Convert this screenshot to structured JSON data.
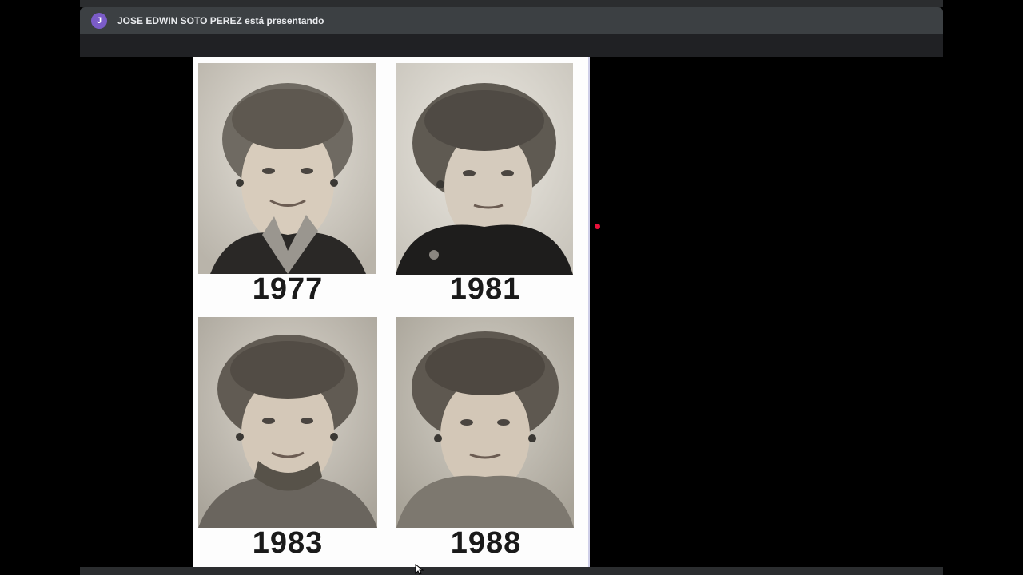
{
  "presenter": {
    "avatar_initial": "J",
    "avatar_color": "#7b5cc8",
    "text": "JOSE EDWIN SOTO PEREZ está presentando"
  },
  "slide": {
    "photos": [
      {
        "year": "1977",
        "subject": "portrait-photo"
      },
      {
        "year": "1981",
        "subject": "portrait-photo"
      },
      {
        "year": "1983",
        "subject": "portrait-photo"
      },
      {
        "year": "1988",
        "subject": "portrait-photo"
      }
    ]
  },
  "colors": {
    "laser_pointer": "#e8103a",
    "presenter_bar": "#3c4043"
  }
}
